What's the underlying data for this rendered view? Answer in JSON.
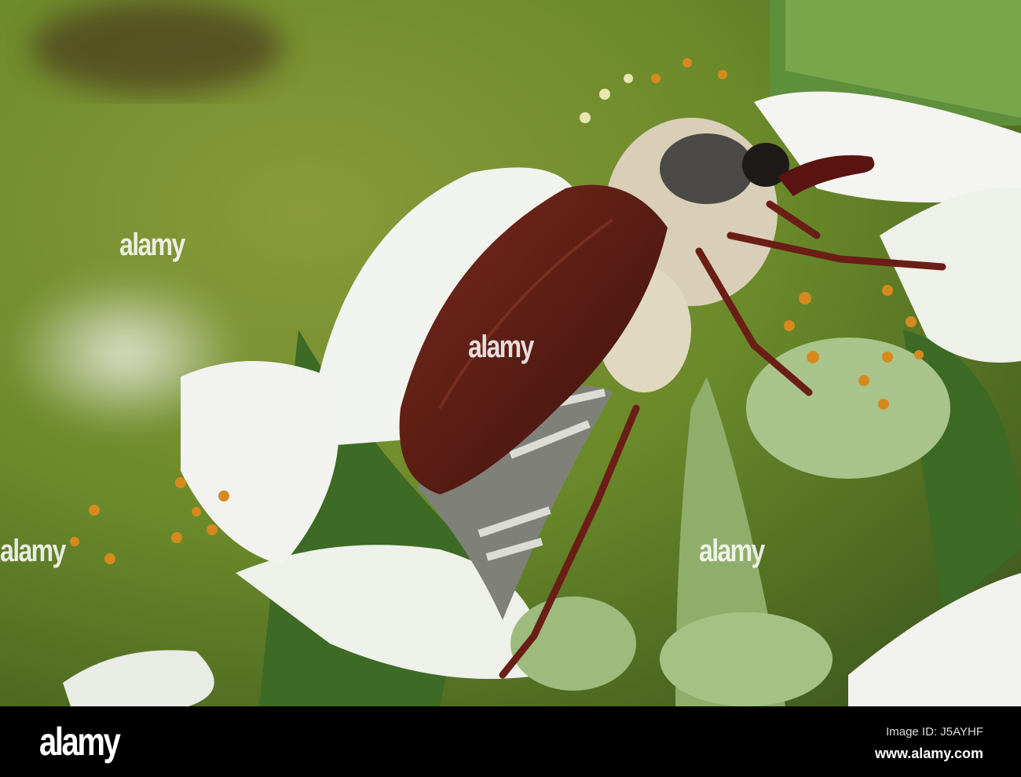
{
  "photo": {
    "subject": "cockchafer beetle on apple blossom",
    "watermark": "alamy"
  },
  "footer": {
    "logo": "alamy",
    "image_id": "Image ID: J5AYHF",
    "url": "www.alamy.com"
  }
}
